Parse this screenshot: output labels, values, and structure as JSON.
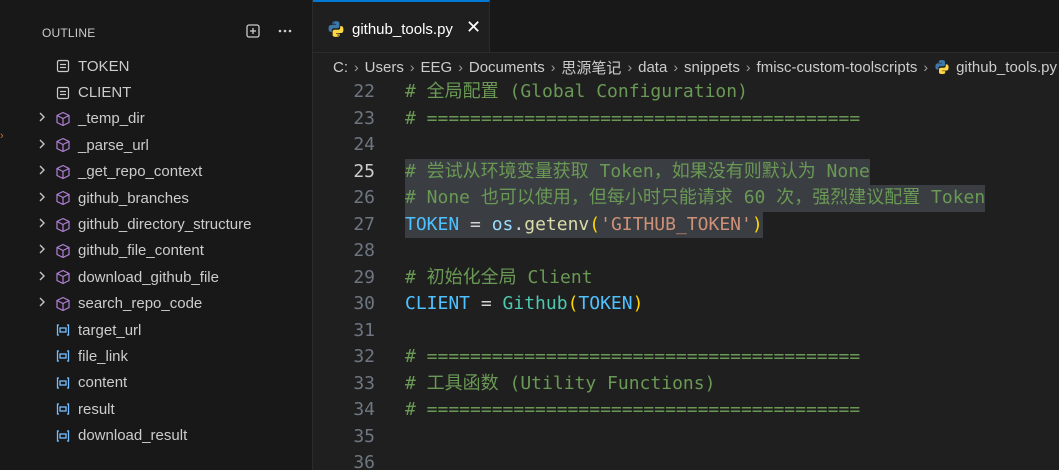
{
  "colors": {
    "accent": "#0078d4",
    "comment": "#6a9955",
    "constant": "#4fc1ff",
    "function": "#dcdcaa",
    "string": "#ce9178",
    "class": "#4ec9b0",
    "symbol_module": "#b180d7",
    "symbol_variable": "#75beff"
  },
  "sidebar": {
    "title": "OUTLINE",
    "items": [
      {
        "label": "TOKEN",
        "icon": "constant-icon",
        "expandable": false
      },
      {
        "label": "CLIENT",
        "icon": "constant-icon",
        "expandable": false
      },
      {
        "label": "_temp_dir",
        "icon": "method-icon",
        "expandable": true
      },
      {
        "label": "_parse_url",
        "icon": "method-icon",
        "expandable": true
      },
      {
        "label": "_get_repo_context",
        "icon": "method-icon",
        "expandable": true
      },
      {
        "label": "github_branches",
        "icon": "method-icon",
        "expandable": true
      },
      {
        "label": "github_directory_structure",
        "icon": "method-icon",
        "expandable": true
      },
      {
        "label": "github_file_content",
        "icon": "method-icon",
        "expandable": true
      },
      {
        "label": "download_github_file",
        "icon": "method-icon",
        "expandable": true
      },
      {
        "label": "search_repo_code",
        "icon": "method-icon",
        "expandable": true
      },
      {
        "label": "target_url",
        "icon": "variable-icon",
        "expandable": false
      },
      {
        "label": "file_link",
        "icon": "variable-icon",
        "expandable": false
      },
      {
        "label": "content",
        "icon": "variable-icon",
        "expandable": false
      },
      {
        "label": "result",
        "icon": "variable-icon",
        "expandable": false
      },
      {
        "label": "download_result",
        "icon": "variable-icon",
        "expandable": false
      }
    ]
  },
  "tab": {
    "filename": "github_tools.py",
    "close_glyph": "✕"
  },
  "breadcrumb": [
    "C:",
    "Users",
    "EEG",
    "Documents",
    "思源笔记",
    "data",
    "snippets",
    "fmisc-custom-toolscripts",
    "github_tools.py"
  ],
  "editor": {
    "active_line": 25,
    "lines": [
      {
        "n": "22",
        "tokens": [
          {
            "t": "# 全局配置 (Global Configuration)",
            "c": "cmt"
          }
        ]
      },
      {
        "n": "23",
        "tokens": [
          {
            "t": "# ========================================",
            "c": "cmt"
          }
        ]
      },
      {
        "n": "24",
        "tokens": []
      },
      {
        "n": "25",
        "hl": true,
        "tokens": [
          {
            "t": "# 尝试从环境变量获取 Token，如果没有则默认为 None",
            "c": "cmt"
          }
        ]
      },
      {
        "n": "26",
        "hl": true,
        "tokens": [
          {
            "t": "# None 也可以使用，但每小时只能请求 60 次，强烈建议配置 Token",
            "c": "cmt"
          }
        ]
      },
      {
        "n": "27",
        "hl": true,
        "tokens": [
          {
            "t": "TOKEN",
            "c": "const"
          },
          {
            "t": " = ",
            "c": "op"
          },
          {
            "t": "os",
            "c": "var"
          },
          {
            "t": ".",
            "c": "op"
          },
          {
            "t": "getenv",
            "c": "fn"
          },
          {
            "t": "(",
            "c": "paren"
          },
          {
            "t": "'GITHUB_TOKEN'",
            "c": "str"
          },
          {
            "t": ")",
            "c": "paren"
          }
        ]
      },
      {
        "n": "28",
        "tokens": []
      },
      {
        "n": "29",
        "tokens": [
          {
            "t": "# 初始化全局 Client",
            "c": "cmt"
          }
        ]
      },
      {
        "n": "30",
        "tokens": [
          {
            "t": "CLIENT",
            "c": "const"
          },
          {
            "t": " = ",
            "c": "op"
          },
          {
            "t": "Github",
            "c": "cls"
          },
          {
            "t": "(",
            "c": "paren"
          },
          {
            "t": "TOKEN",
            "c": "const"
          },
          {
            "t": ")",
            "c": "paren"
          }
        ]
      },
      {
        "n": "31",
        "tokens": []
      },
      {
        "n": "32",
        "tokens": [
          {
            "t": "# ========================================",
            "c": "cmt"
          }
        ]
      },
      {
        "n": "33",
        "tokens": [
          {
            "t": "# 工具函数 (Utility Functions)",
            "c": "cmt"
          }
        ]
      },
      {
        "n": "34",
        "tokens": [
          {
            "t": "# ========================================",
            "c": "cmt"
          }
        ]
      },
      {
        "n": "35",
        "tokens": []
      },
      {
        "n": "36",
        "tokens": []
      }
    ]
  }
}
